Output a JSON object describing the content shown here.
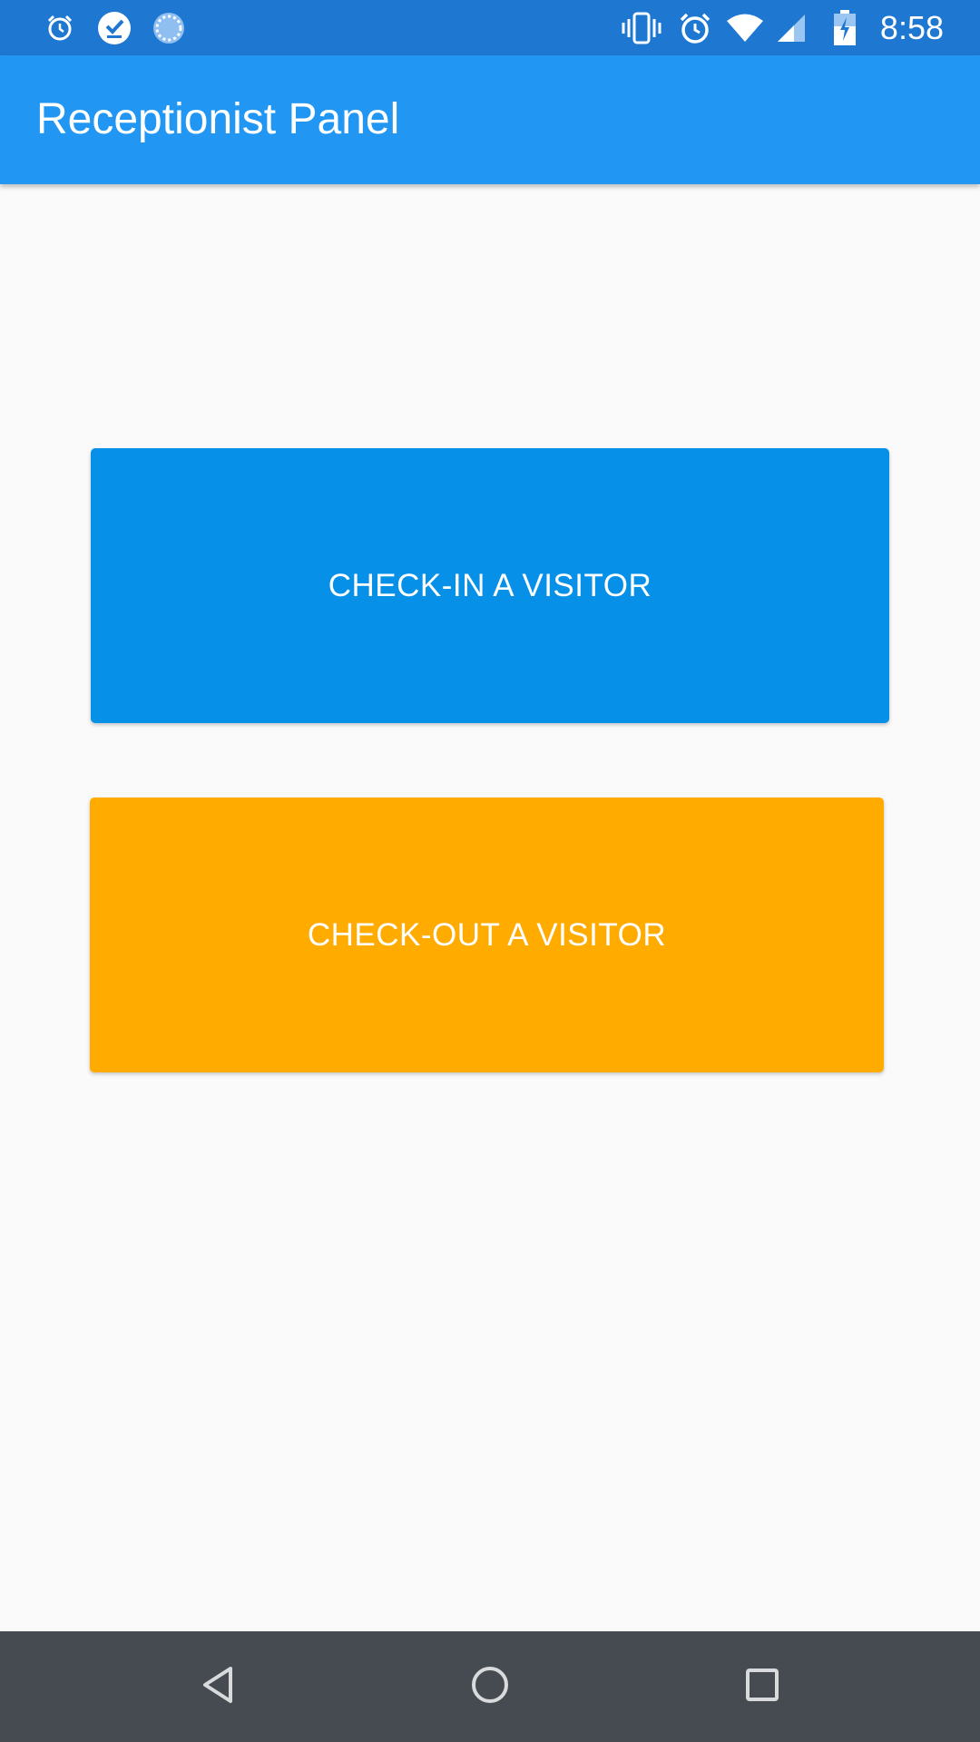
{
  "status_bar": {
    "time": "8:58",
    "left_icons": [
      "alarm-icon",
      "check-download-icon",
      "sync-spinner-icon"
    ],
    "right_icons": [
      "vibrate-icon",
      "alarm-icon",
      "wifi-icon",
      "cellular-signal-icon",
      "battery-charging-icon"
    ],
    "background": "#1e78d2"
  },
  "app_bar": {
    "title": "Receptionist Panel",
    "background": "#2196f3"
  },
  "main": {
    "checkin_button": {
      "label": "CHECK-IN A VISITOR",
      "color": "#0690e8"
    },
    "checkout_button": {
      "label": "CHECK-OUT A VISITOR",
      "color": "#ffab00"
    }
  },
  "nav_bar": {
    "buttons": [
      "back-icon",
      "home-icon",
      "recents-icon"
    ],
    "background": "#454b51"
  }
}
